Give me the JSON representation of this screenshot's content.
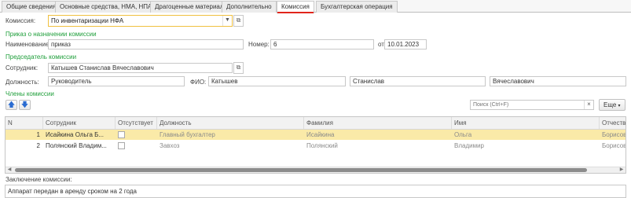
{
  "tabs": [
    {
      "label": "Общие сведения"
    },
    {
      "label": "Основные средства, НМА, НПА"
    },
    {
      "label": "Драгоценные материалы"
    },
    {
      "label": "Дополнительно"
    },
    {
      "label": "Комиссия"
    },
    {
      "label": "Бухгалтерская операция"
    }
  ],
  "commission": {
    "label": "Комиссия:",
    "value": "По инвентаризации НФА"
  },
  "order": {
    "section": "Приказ о назначении комиссии",
    "name_label": "Наименование:",
    "name_value": "приказ",
    "number_label": "Номер:",
    "number_value": "6",
    "date_label": "от:",
    "date_value": "10.01.2023"
  },
  "chairman": {
    "section": "Председатель комиссии",
    "employee_label": "Сотрудник:",
    "employee_value": "Катышев Станислав Вячеславович",
    "position_label": "Должность:",
    "position_value": "Руководитель",
    "fio_label": "ФИО:",
    "last_name": "Катышев",
    "first_name": "Станислав",
    "patronymic": "Вячеславович"
  },
  "members": {
    "section": "Члены комиссии",
    "search_placeholder": "Поиск (Ctrl+F)",
    "more_label": "Еще",
    "columns": [
      "N",
      "Сотрудник",
      "Отсутствует",
      "Должность",
      "Фамилия",
      "Имя",
      "Отчество"
    ],
    "rows": [
      {
        "n": "1",
        "employee": "Исайкина Ольга Б...",
        "position": "Главный бухгалтер",
        "last_name": "Исайкина",
        "first_name": "Ольга",
        "patronymic": "Борисов"
      },
      {
        "n": "2",
        "employee": "Полянский Владим...",
        "position": "Завхоз",
        "last_name": "Полянский",
        "first_name": "Владимир",
        "patronymic": "Борисов"
      }
    ]
  },
  "conclusion": {
    "label": "Заключение комиссии:",
    "value": "Аппарат передан в аренду сроком на 2 года"
  },
  "icons": {
    "move_up": "arrow-up-icon",
    "move_down": "arrow-down-icon",
    "open": "open-link-icon",
    "clear": "close-icon",
    "dropdown": "chevron-down-icon"
  },
  "colors": {
    "section_title": "#1e9e3a",
    "active_tab_underline": "#e1251b",
    "selected_row": "#faeaa8",
    "focus_border": "#f0c040"
  }
}
